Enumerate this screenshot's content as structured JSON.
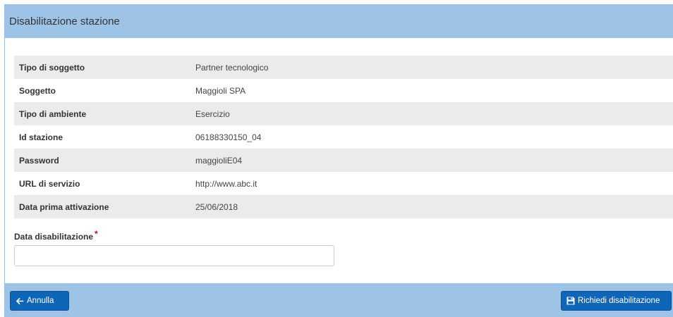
{
  "header": {
    "title": "Disabilitazione stazione"
  },
  "details": [
    {
      "label": "Tipo di soggetto",
      "value": "Partner tecnologico"
    },
    {
      "label": "Soggetto",
      "value": "Maggioli SPA"
    },
    {
      "label": "Tipo di ambiente",
      "value": "Esercizio"
    },
    {
      "label": "Id stazione",
      "value": "06188330150_04"
    },
    {
      "label": "Password",
      "value": "maggioliE04"
    },
    {
      "label": "URL di servizio",
      "value": "http://www.abc.it"
    },
    {
      "label": "Data prima attivazione",
      "value": "25/06/2018"
    }
  ],
  "form": {
    "date_label": "Data disabilitazione",
    "required_mark": "*",
    "date_value": ""
  },
  "footer": {
    "cancel_label": "Annulla",
    "cancel_icon": "arrow-left-icon",
    "submit_label": "Richiedi disabilitazione",
    "submit_icon": "save-icon"
  },
  "colors": {
    "header_bg": "#9dc3e6",
    "button_bg": "#0f66b9",
    "required": "#d0021b",
    "row_alt": "#ebebeb"
  }
}
